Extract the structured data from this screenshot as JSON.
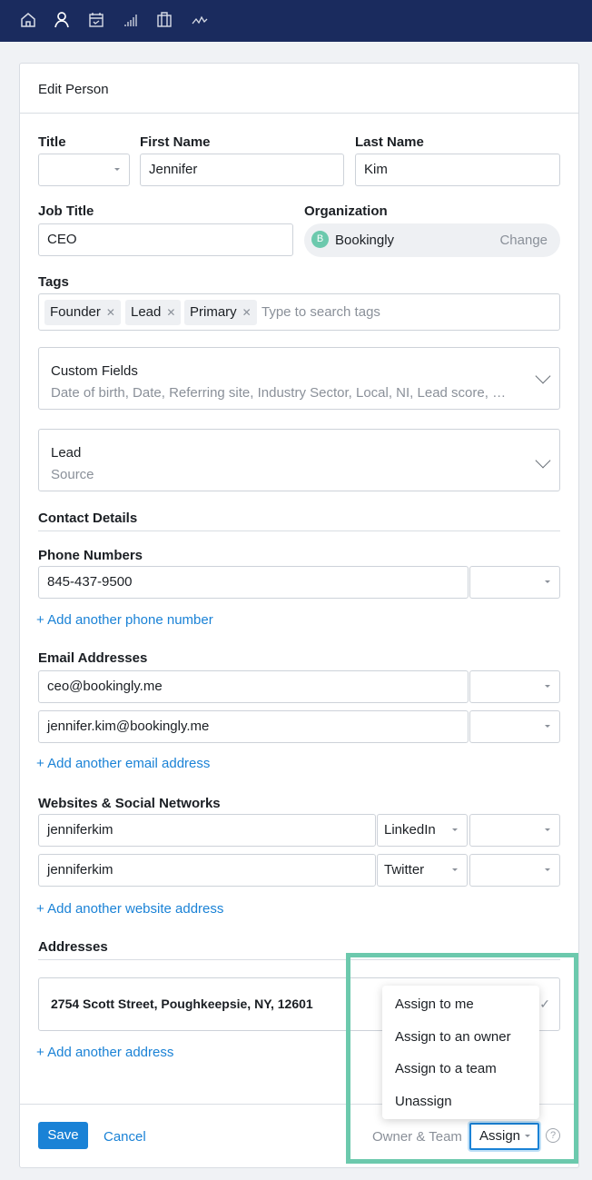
{
  "nav": {
    "icons": [
      "home-icon",
      "person-icon",
      "calendar-icon",
      "stats-icon",
      "briefcase-icon",
      "activity-icon"
    ]
  },
  "header": {
    "title": "Edit Person"
  },
  "form": {
    "title_label": "Title",
    "title_value": "",
    "first_name_label": "First Name",
    "first_name": "Jennifer",
    "last_name_label": "Last Name",
    "last_name": "Kim",
    "job_title_label": "Job Title",
    "job_title": "CEO",
    "organization_label": "Organization",
    "organization": "Bookingly",
    "organization_initial": "B",
    "organization_change": "Change",
    "tags_label": "Tags",
    "tags": [
      "Founder",
      "Lead",
      "Primary"
    ],
    "tags_placeholder": "Type to search tags",
    "custom_fields": {
      "title": "Custom Fields",
      "summary": "Date of birth, Date, Referring site, Industry Sector, Local, NI, Lead score, …"
    },
    "lead": {
      "title": "Lead",
      "summary": "Source"
    },
    "contact_details": "Contact Details",
    "phone_label": "Phone Numbers",
    "phones": [
      "845-437-9500"
    ],
    "add_phone": "+ Add another phone number",
    "email_label": "Email Addresses",
    "emails": [
      "ceo@bookingly.me",
      "jennifer.kim@bookingly.me"
    ],
    "add_email": "+ Add another email address",
    "websites_label": "Websites & Social Networks",
    "websites": [
      {
        "value": "jenniferkim",
        "type": "LinkedIn"
      },
      {
        "value": "jenniferkim",
        "type": "Twitter"
      }
    ],
    "add_website": "+ Add another website address",
    "addresses_label": "Addresses",
    "address": "2754 Scott Street, Poughkeepsie, NY, 12601",
    "add_address": "+ Add another address"
  },
  "footer": {
    "save": "Save",
    "cancel": "Cancel",
    "owner_team": "Owner & Team",
    "assign": "Assign"
  },
  "assign_menu": [
    "Assign to me",
    "Assign to an owner",
    "Assign to a team",
    "Unassign"
  ],
  "colors": {
    "nav": "#1a2b5e",
    "primary": "#1a82d6",
    "highlight": "#6cc9ad"
  }
}
